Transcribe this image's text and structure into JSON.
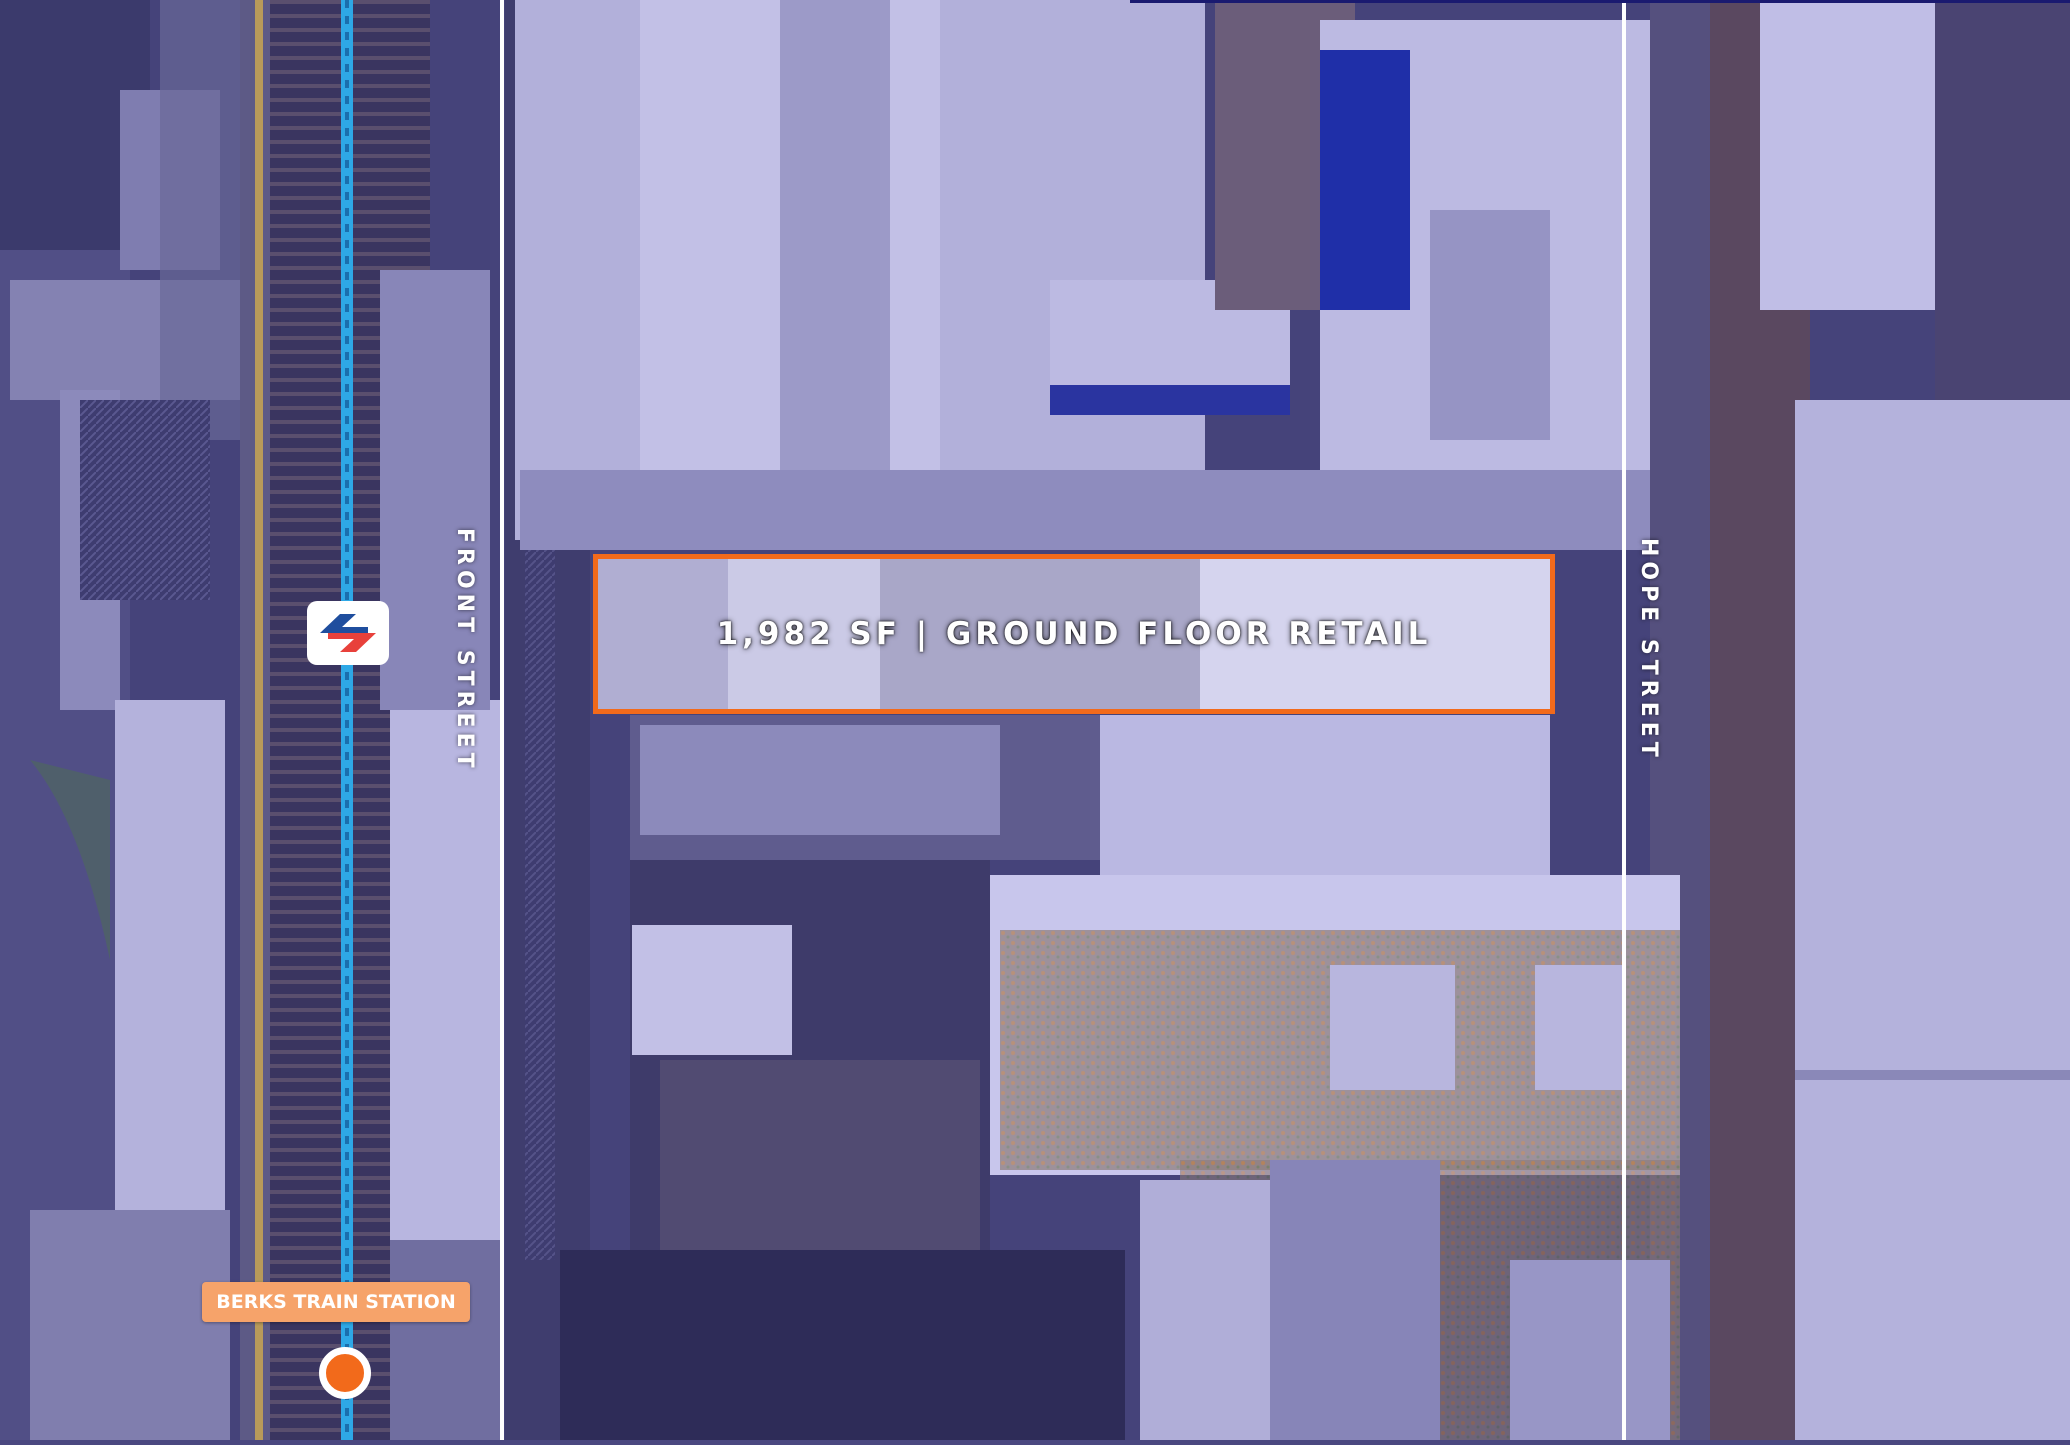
{
  "map": {
    "streets": {
      "front": "FRONT STREET",
      "hope": "HOPE STREET"
    },
    "property": {
      "label": "1,982 SF | GROUND FLOOR RETAIL"
    },
    "station": {
      "label": "BERKS TRAIN STATION"
    },
    "icons": {
      "transit": "septa-logo-icon",
      "station": "station-marker-icon"
    },
    "colors": {
      "overlay": "#4a4880",
      "accent_orange": "#f26a1b",
      "badge_orange": "#f6a36a",
      "rail_line_blue": "#2ea8e6",
      "street_line": "#ffffff",
      "septa_blue": "#1f4e9e",
      "septa_red": "#e8413b"
    }
  }
}
